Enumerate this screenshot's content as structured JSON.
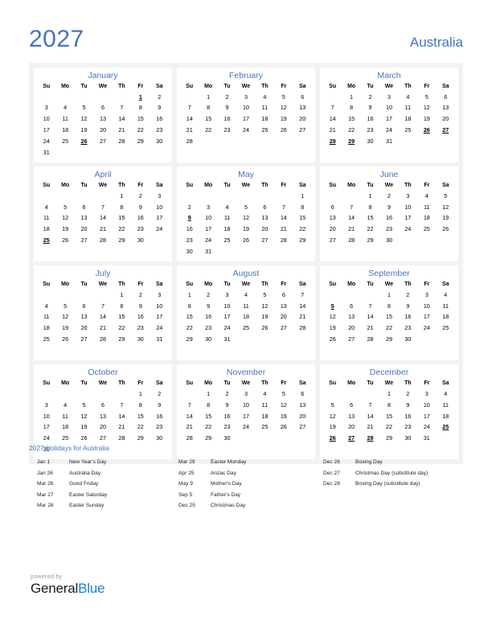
{
  "header": {
    "year": "2027",
    "country": "Australia"
  },
  "colors": {
    "accent": "#4574c4",
    "holiday": "#e00000",
    "band_background": "#f2f2f2",
    "card_background": "#ffffff",
    "logo_blue": "#1a7fd4"
  },
  "weekday_headers": [
    "Su",
    "Mo",
    "Tu",
    "We",
    "Th",
    "Fr",
    "Sa"
  ],
  "months": [
    {
      "name": "January",
      "weeks": [
        [
          "",
          "",
          "",
          "",
          "",
          "1",
          "2"
        ],
        [
          "3",
          "4",
          "5",
          "6",
          "7",
          "8",
          "9"
        ],
        [
          "10",
          "11",
          "12",
          "13",
          "14",
          "15",
          "16"
        ],
        [
          "17",
          "18",
          "19",
          "20",
          "21",
          "22",
          "23"
        ],
        [
          "24",
          "25",
          "26",
          "27",
          "28",
          "29",
          "30"
        ],
        [
          "31",
          "",
          "",
          "",
          "",
          "",
          ""
        ]
      ],
      "holidays": [
        "1",
        "26"
      ]
    },
    {
      "name": "February",
      "weeks": [
        [
          "",
          "1",
          "2",
          "3",
          "4",
          "5",
          "6"
        ],
        [
          "7",
          "8",
          "9",
          "10",
          "11",
          "12",
          "13"
        ],
        [
          "14",
          "15",
          "16",
          "17",
          "18",
          "19",
          "20"
        ],
        [
          "21",
          "22",
          "23",
          "24",
          "25",
          "26",
          "27"
        ],
        [
          "28",
          "",
          "",
          "",
          "",
          "",
          ""
        ],
        [
          "",
          "",
          "",
          "",
          "",
          "",
          ""
        ]
      ],
      "holidays": []
    },
    {
      "name": "March",
      "weeks": [
        [
          "",
          "1",
          "2",
          "3",
          "4",
          "5",
          "6"
        ],
        [
          "7",
          "8",
          "9",
          "10",
          "11",
          "12",
          "13"
        ],
        [
          "14",
          "15",
          "16",
          "17",
          "18",
          "19",
          "20"
        ],
        [
          "21",
          "22",
          "23",
          "24",
          "25",
          "26",
          "27"
        ],
        [
          "28",
          "29",
          "30",
          "31",
          "",
          "",
          ""
        ],
        [
          "",
          "",
          "",
          "",
          "",
          "",
          ""
        ]
      ],
      "holidays": [
        "26",
        "27",
        "28",
        "29"
      ]
    },
    {
      "name": "April",
      "weeks": [
        [
          "",
          "",
          "",
          "",
          "1",
          "2",
          "3"
        ],
        [
          "4",
          "5",
          "6",
          "7",
          "8",
          "9",
          "10"
        ],
        [
          "11",
          "12",
          "13",
          "14",
          "15",
          "16",
          "17"
        ],
        [
          "18",
          "19",
          "20",
          "21",
          "22",
          "23",
          "24"
        ],
        [
          "25",
          "26",
          "27",
          "28",
          "29",
          "30",
          ""
        ],
        [
          "",
          "",
          "",
          "",
          "",
          "",
          ""
        ]
      ],
      "holidays": [
        "25"
      ]
    },
    {
      "name": "May",
      "weeks": [
        [
          "",
          "",
          "",
          "",
          "",
          "",
          "1"
        ],
        [
          "2",
          "3",
          "4",
          "5",
          "6",
          "7",
          "8"
        ],
        [
          "9",
          "10",
          "11",
          "12",
          "13",
          "14",
          "15"
        ],
        [
          "16",
          "17",
          "18",
          "19",
          "20",
          "21",
          "22"
        ],
        [
          "23",
          "24",
          "25",
          "26",
          "27",
          "28",
          "29"
        ],
        [
          "30",
          "31",
          "",
          "",
          "",
          "",
          ""
        ]
      ],
      "holidays": [
        "9"
      ]
    },
    {
      "name": "June",
      "weeks": [
        [
          "",
          "",
          "1",
          "2",
          "3",
          "4",
          "5"
        ],
        [
          "6",
          "7",
          "8",
          "9",
          "10",
          "11",
          "12"
        ],
        [
          "13",
          "14",
          "15",
          "16",
          "17",
          "18",
          "19"
        ],
        [
          "20",
          "21",
          "22",
          "23",
          "24",
          "25",
          "26"
        ],
        [
          "27",
          "28",
          "29",
          "30",
          "",
          "",
          ""
        ],
        [
          "",
          "",
          "",
          "",
          "",
          "",
          ""
        ]
      ],
      "holidays": []
    },
    {
      "name": "July",
      "weeks": [
        [
          "",
          "",
          "",
          "",
          "1",
          "2",
          "3"
        ],
        [
          "4",
          "5",
          "6",
          "7",
          "8",
          "9",
          "10"
        ],
        [
          "11",
          "12",
          "13",
          "14",
          "15",
          "16",
          "17"
        ],
        [
          "18",
          "19",
          "20",
          "21",
          "22",
          "23",
          "24"
        ],
        [
          "25",
          "26",
          "27",
          "28",
          "29",
          "30",
          "31"
        ],
        [
          "",
          "",
          "",
          "",
          "",
          "",
          ""
        ]
      ],
      "holidays": []
    },
    {
      "name": "August",
      "weeks": [
        [
          "1",
          "2",
          "3",
          "4",
          "5",
          "6",
          "7"
        ],
        [
          "8",
          "9",
          "10",
          "11",
          "12",
          "13",
          "14"
        ],
        [
          "15",
          "16",
          "17",
          "18",
          "19",
          "20",
          "21"
        ],
        [
          "22",
          "23",
          "24",
          "25",
          "26",
          "27",
          "28"
        ],
        [
          "29",
          "30",
          "31",
          "",
          "",
          "",
          ""
        ],
        [
          "",
          "",
          "",
          "",
          "",
          "",
          ""
        ]
      ],
      "holidays": []
    },
    {
      "name": "September",
      "weeks": [
        [
          "",
          "",
          "",
          "1",
          "2",
          "3",
          "4"
        ],
        [
          "5",
          "6",
          "7",
          "8",
          "9",
          "10",
          "11"
        ],
        [
          "12",
          "13",
          "14",
          "15",
          "16",
          "17",
          "18"
        ],
        [
          "19",
          "20",
          "21",
          "22",
          "23",
          "24",
          "25"
        ],
        [
          "26",
          "27",
          "28",
          "29",
          "30",
          "",
          ""
        ],
        [
          "",
          "",
          "",
          "",
          "",
          "",
          ""
        ]
      ],
      "holidays": [
        "5"
      ]
    },
    {
      "name": "October",
      "weeks": [
        [
          "",
          "",
          "",
          "",
          "",
          "1",
          "2"
        ],
        [
          "3",
          "4",
          "5",
          "6",
          "7",
          "8",
          "9"
        ],
        [
          "10",
          "11",
          "12",
          "13",
          "14",
          "15",
          "16"
        ],
        [
          "17",
          "18",
          "19",
          "20",
          "21",
          "22",
          "23"
        ],
        [
          "24",
          "25",
          "26",
          "27",
          "28",
          "29",
          "30"
        ],
        [
          "31",
          "",
          "",
          "",
          "",
          "",
          ""
        ]
      ],
      "holidays": []
    },
    {
      "name": "November",
      "weeks": [
        [
          "",
          "1",
          "2",
          "3",
          "4",
          "5",
          "6"
        ],
        [
          "7",
          "8",
          "9",
          "10",
          "11",
          "12",
          "13"
        ],
        [
          "14",
          "15",
          "16",
          "17",
          "18",
          "19",
          "20"
        ],
        [
          "21",
          "22",
          "23",
          "24",
          "25",
          "26",
          "27"
        ],
        [
          "28",
          "29",
          "30",
          "",
          "",
          "",
          ""
        ],
        [
          "",
          "",
          "",
          "",
          "",
          "",
          ""
        ]
      ],
      "holidays": []
    },
    {
      "name": "December",
      "weeks": [
        [
          "",
          "",
          "",
          "1",
          "2",
          "3",
          "4"
        ],
        [
          "5",
          "6",
          "7",
          "8",
          "9",
          "10",
          "11"
        ],
        [
          "12",
          "13",
          "14",
          "15",
          "16",
          "17",
          "18"
        ],
        [
          "19",
          "20",
          "21",
          "22",
          "23",
          "24",
          "25"
        ],
        [
          "26",
          "27",
          "28",
          "29",
          "30",
          "31",
          ""
        ],
        [
          "",
          "",
          "",
          "",
          "",
          "",
          ""
        ]
      ],
      "holidays": [
        "25",
        "26",
        "27",
        "28"
      ]
    }
  ],
  "legend": {
    "title": "2027 Holidays for Australia",
    "columns": [
      [
        {
          "date": "Jan 1",
          "name": "New Year's Day"
        },
        {
          "date": "Jan 26",
          "name": "Australia Day"
        },
        {
          "date": "Mar 26",
          "name": "Good Friday"
        },
        {
          "date": "Mar 27",
          "name": "Easter Saturday"
        },
        {
          "date": "Mar 28",
          "name": "Easter Sunday"
        }
      ],
      [
        {
          "date": "Mar 29",
          "name": "Easter Monday"
        },
        {
          "date": "Apr 25",
          "name": "Anzac Day"
        },
        {
          "date": "May 9",
          "name": "Mother's Day"
        },
        {
          "date": "Sep 5",
          "name": "Father's Day"
        },
        {
          "date": "Dec 25",
          "name": "Christmas Day"
        }
      ],
      [
        {
          "date": "Dec 26",
          "name": "Boxing Day"
        },
        {
          "date": "Dec 27",
          "name": "Christmas Day (substitute day)"
        },
        {
          "date": "Dec 28",
          "name": "Boxing Day (substitute day)"
        }
      ]
    ]
  },
  "footer": {
    "powered_by": "powered by",
    "logo_first": "General",
    "logo_second": "Blue"
  }
}
